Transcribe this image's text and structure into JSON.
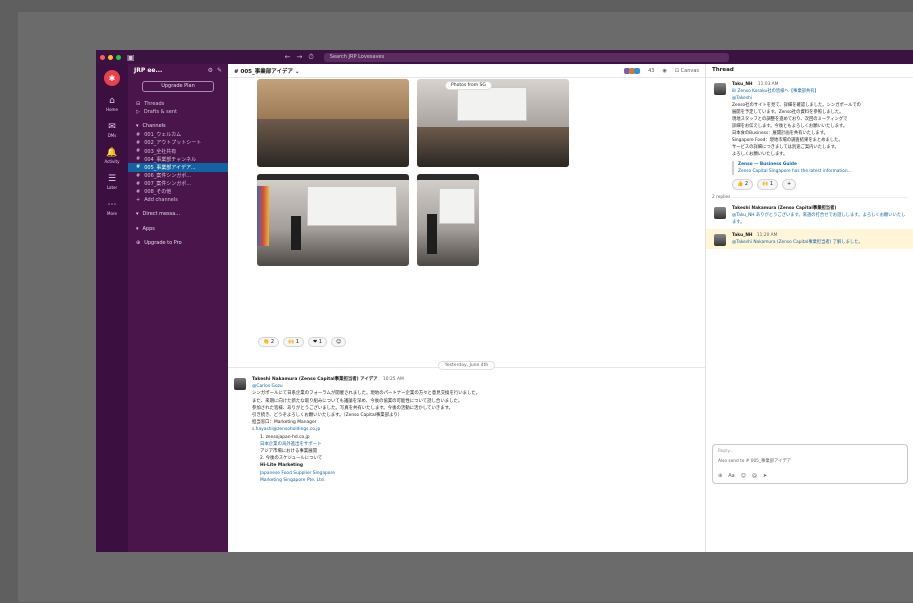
{
  "app": {
    "workspace": "JRP ee...",
    "search_placeholder": "Search JRP Lovesaves",
    "nav_back": "←",
    "nav_fwd": "→",
    "history": "⏱"
  },
  "rail": {
    "items": [
      {
        "icon": "⌂",
        "label": "Home"
      },
      {
        "icon": "✉",
        "label": "DMs"
      },
      {
        "icon": "🔔",
        "label": "Activity"
      },
      {
        "icon": "☰",
        "label": "Later"
      },
      {
        "icon": "⋯",
        "label": "More"
      }
    ]
  },
  "sidebar": {
    "upgrade_button": "Upgrade Plan",
    "items": [
      {
        "icon": "⊟",
        "label": "Threads",
        "active": false
      },
      {
        "icon": "▷",
        "label": "Drafts & sent",
        "active": false
      },
      {
        "icon": "▾",
        "label": "Channels",
        "active": false,
        "section": true
      },
      {
        "icon": "#",
        "label": "001_ウェルカム",
        "active": false
      },
      {
        "icon": "#",
        "label": "002_アウトプットシート",
        "active": false
      },
      {
        "icon": "#",
        "label": "003_全社共有",
        "active": false
      },
      {
        "icon": "#",
        "label": "004_事業部チャンネル",
        "active": false
      },
      {
        "icon": "#",
        "label": "005_事業部アイデア...",
        "active": true
      },
      {
        "icon": "#",
        "label": "006_案件シンガポ...",
        "active": false
      },
      {
        "icon": "#",
        "label": "007_案件シンガポ...",
        "active": false
      },
      {
        "icon": "#",
        "label": "008_その他",
        "active": false
      },
      {
        "icon": "+",
        "label": "Add channels",
        "active": false
      },
      {
        "icon": "▾",
        "label": "Direct messa...",
        "active": false,
        "section": true
      },
      {
        "icon": "▾",
        "label": "Apps",
        "active": false,
        "section": true
      },
      {
        "icon": "⊕",
        "label": "Upgrade to Pro",
        "active": false,
        "section": true
      }
    ]
  },
  "channel": {
    "name": "# 005_事業部アイデア ⌄",
    "member_count": "43",
    "header_actions": [
      "◉",
      "⊡ Canvas"
    ],
    "photo_tag": "Photos from SG",
    "reactions": [
      "👏 2",
      "🙌 1",
      "❤ 1",
      "☺"
    ],
    "date_divider": "Yesterday, June 4th",
    "message": {
      "author": "Takeshi Nakamura (Zenso Capital事業担当者) アイデア",
      "time": "10:25 AM",
      "sub_link": "@Carlos Gozu",
      "lines": [
        "シンガポールにて日系企業のフォーラムが開催されました。現地のパートナー企業の方々と意見交換を行いました。",
        "また、来期に向けた新たな取り組みについても議論を深め、今後の協業の可能性について話し合いました。",
        "参加された皆様、ありがとうございました。写真を共有いたします。今後の活動に活かしていきます。",
        "引き続き、どうぞよろしくお願いいたします。（Zenso Capital事業部より）"
      ],
      "contact_label": "担当窓口：Marketing Manager",
      "contact_link": "s.hayashi@zensoholdings.co.jp",
      "list_items": [
        "1. zensojapan-hd.co.jp",
        "日本企業の海外進出をサポート",
        "アジア市場における事業展開",
        "2. 今後のスケジュールについて"
      ],
      "company_label": "Hi-Lite Marketing",
      "company_lines": [
        "Japanese Food Supplier Singapore",
        "Marketing Singapore Pte. Ltd."
      ]
    }
  },
  "thread": {
    "title": "Thread",
    "parent": {
      "author": "Taku_NH",
      "time": "11:03 AM",
      "text_lines": [
        "8/ Zenso Kosaku社の皆様へ【事業部共有】",
        "@Takeshi",
        "Zenso社のサイトを見て、詳細を確認しました。シンガポールでの",
        "展開を予定しています。Zenso社の資料を参照しました。",
        "現地スタッフとの調整を進めており、次回のミーティングで",
        "詳細をお伝えします。今後ともよろしくお願いいたします。",
        "日本食のBusiness：展開計画を共有いたします。",
        "Singapore Food：現地市場の調査結果をまとめました。",
        "サービスの詳細につきましては別途ご案内いたします。",
        "よろしくお願いいたします。"
      ],
      "quote_title": "Zenso — Business Guide",
      "quote_text": "Zenso Capital Singapore has the latest information...",
      "reactions": [
        "👍 2",
        "🙌 1",
        "+"
      ]
    },
    "replies_label": "2 replies",
    "replies": [
      {
        "author": "Takeshi Nakamura (Zenso Capital事業担当者)",
        "text": "@Taku_NH ありがとうございます。来週の打合せでお話しします。よろしくお願いいたします。"
      },
      {
        "author": "Taku_NH",
        "time": "11:20 AM",
        "text": "@Takeshi Nakamura (Zenso Capital事業担当者) 了解しました。"
      }
    ],
    "composer_placeholder": "Reply...",
    "also_send": "Also send to # 005_事業部アイデア"
  },
  "colors": {
    "aubergine": "#4a154b",
    "rail": "#3b0f40",
    "active": "#1164a3",
    "link": "#1264a3"
  }
}
